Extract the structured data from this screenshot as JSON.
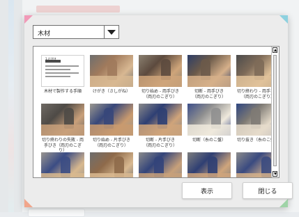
{
  "dropdown": {
    "selected": "木材"
  },
  "items": [
    {
      "caption": "木材で製作する手順",
      "kind": "doc",
      "doc_title": "1.けがき"
    },
    {
      "caption": "けがき（さしがね）",
      "kind": "photo",
      "palette": [
        "#a07a5c",
        "#d8b892",
        "#6e6e6e"
      ]
    },
    {
      "caption": "切り始め - 両手びき\n（両刃のこぎり）",
      "kind": "photo",
      "palette": [
        "#5c4a3e",
        "#cfa57a",
        "#8a8070"
      ]
    },
    {
      "caption": "切断 - 両手びき\n（両刃のこぎり）",
      "kind": "photo",
      "palette": [
        "#6b5a4a",
        "#d6b08a",
        "#2d3d66"
      ]
    },
    {
      "caption": "切り終わり - 両手びき\n（両刃のこぎり）",
      "kind": "photo",
      "palette": [
        "#7d6a58",
        "#e0c29a",
        "#4b4b4b"
      ]
    },
    {
      "caption": "切り終わりの失敗 - 両\n手びき（両刃のこぎり）",
      "kind": "photo",
      "palette": [
        "#4e4a46",
        "#c9a07a",
        "#6f6a64"
      ]
    },
    {
      "caption": "切り始め - 片手びき\n（両刃のこぎり）",
      "kind": "photo",
      "palette": [
        "#37477a",
        "#c99a6e",
        "#9b9890"
      ]
    },
    {
      "caption": "切断 - 片手びき\n（両刃のこぎり）",
      "kind": "photo",
      "palette": [
        "#2e3f73",
        "#d0a47a",
        "#8a8a8a"
      ]
    },
    {
      "caption": "切断（糸のこ盤）",
      "kind": "photo",
      "palette": [
        "#8f8f8f",
        "#efe9dc",
        "#3d4f8a"
      ]
    },
    {
      "caption": "切り抜き（糸のこ盤）",
      "kind": "photo",
      "palette": [
        "#7e7a74",
        "#e6dccb",
        "#304781"
      ]
    },
    {
      "caption": "",
      "kind": "photo",
      "palette": [
        "#3b4c84",
        "#d8b88e",
        "#9a9690"
      ]
    },
    {
      "caption": "",
      "kind": "photo",
      "palette": [
        "#8e6a4a",
        "#d9b991",
        "#6d6d6d"
      ]
    },
    {
      "caption": "",
      "kind": "photo",
      "palette": [
        "#33447a",
        "#c7a07a",
        "#8b8b8b"
      ]
    },
    {
      "caption": "",
      "kind": "photo",
      "palette": [
        "#2f3f73",
        "#cfa57c",
        "#7e7e7e"
      ]
    },
    {
      "caption": "",
      "kind": "photo",
      "palette": [
        "#3a4a80",
        "#d4b08a",
        "#8c8c8c"
      ]
    }
  ],
  "buttons": {
    "show": "表示",
    "close": "閉じる"
  },
  "colors": {
    "corner_pink": "#f19ab8",
    "corner_cyan": "#8dd1df",
    "corner_orange": "#f1a58b",
    "corner_green": "#9fd3a7"
  }
}
